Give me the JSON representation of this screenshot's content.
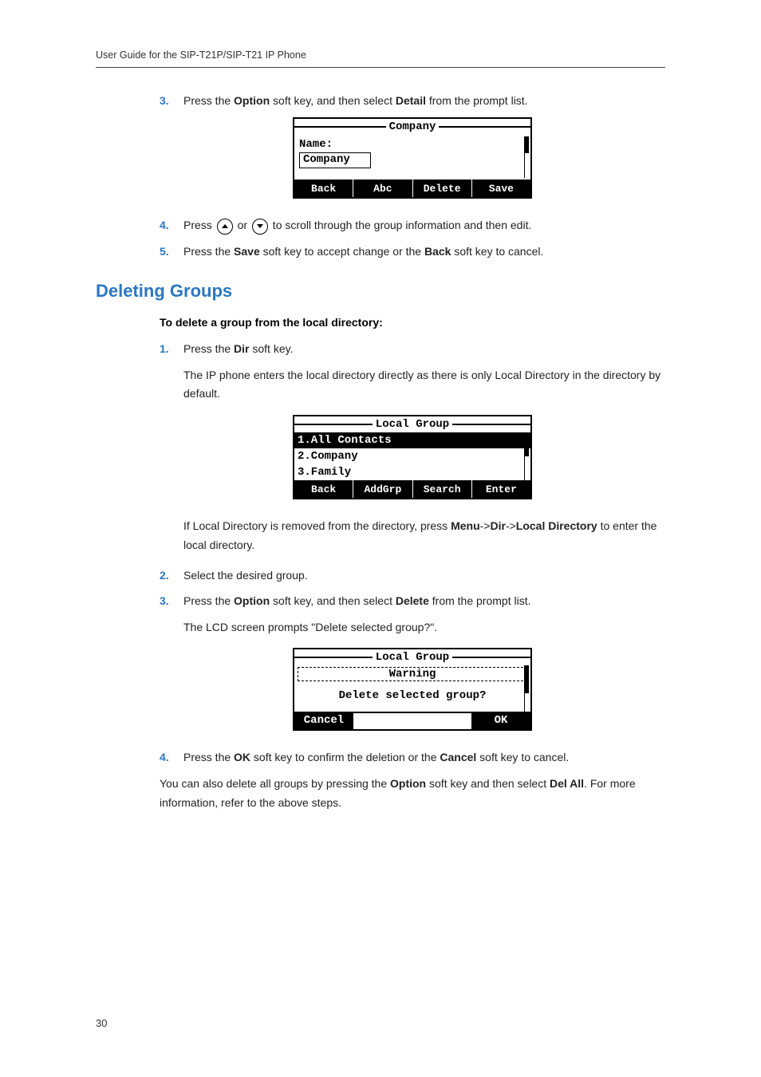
{
  "header": {
    "title": "User Guide for the SIP-T21P/SIP-T21 IP Phone"
  },
  "step3": {
    "num": "3.",
    "pre": "Press the ",
    "b1": "Option",
    "mid": " soft key, and then select ",
    "b2": "Detail",
    "post": " from the prompt list."
  },
  "lcd1": {
    "title": "Company",
    "name_label": "Name:",
    "name_value": "Company",
    "keys": [
      "Back",
      "Abc",
      "Delete",
      "Save"
    ]
  },
  "step4": {
    "num": "4.",
    "pre": "Press ",
    "mid": " or ",
    "post": " to scroll through the group information and then edit."
  },
  "step5": {
    "num": "5.",
    "pre": "Press the ",
    "b1": "Save",
    "mid": " soft key to accept change or the ",
    "b2": "Back",
    "post": " soft key to cancel."
  },
  "section": {
    "title": "Deleting Groups"
  },
  "subhead": "To delete a group from the local directory:",
  "d1": {
    "num": "1.",
    "pre": "Press the ",
    "b1": "Dir",
    "post": " soft key."
  },
  "d1_para": "The IP phone enters the local directory directly as there is only Local Directory in the directory by default.",
  "lcd2": {
    "title": "Local Group",
    "items": [
      "1.All Contacts",
      "2.Company",
      "3.Family"
    ],
    "keys": [
      "Back",
      "AddGrp",
      "Search",
      "Enter"
    ]
  },
  "d1_after_pre": "If Local Directory is removed from the directory, press ",
  "d1_after_b1": "Menu",
  "d1_after_arrow": "->",
  "d1_after_b2": "Dir",
  "d1_after_b3": "Local Directory",
  "d1_after_post": " to enter the local directory.",
  "d2": {
    "num": "2.",
    "text": "Select the desired group."
  },
  "d3": {
    "num": "3.",
    "pre": "Press the ",
    "b1": "Option",
    "mid": " soft key, and then select ",
    "b2": "Delete",
    "post": " from the prompt list."
  },
  "d3_para": "The LCD screen prompts \"Delete selected group?\".",
  "lcd3": {
    "title": "Local Group",
    "warning": "Warning",
    "prompt": "Delete selected group?",
    "cancel": "Cancel",
    "ok": "OK"
  },
  "d4": {
    "num": "4.",
    "pre": "Press the ",
    "b1": "OK",
    "mid": " soft key to confirm the deletion or the ",
    "b2": "Cancel",
    "post": " soft key to cancel."
  },
  "closing_pre": "You can also delete all groups by pressing the ",
  "closing_b1": "Option",
  "closing_mid": " soft key and then select ",
  "closing_b2": "Del All",
  "closing_post": ". For more information, refer to the above steps.",
  "pagenum": "30"
}
